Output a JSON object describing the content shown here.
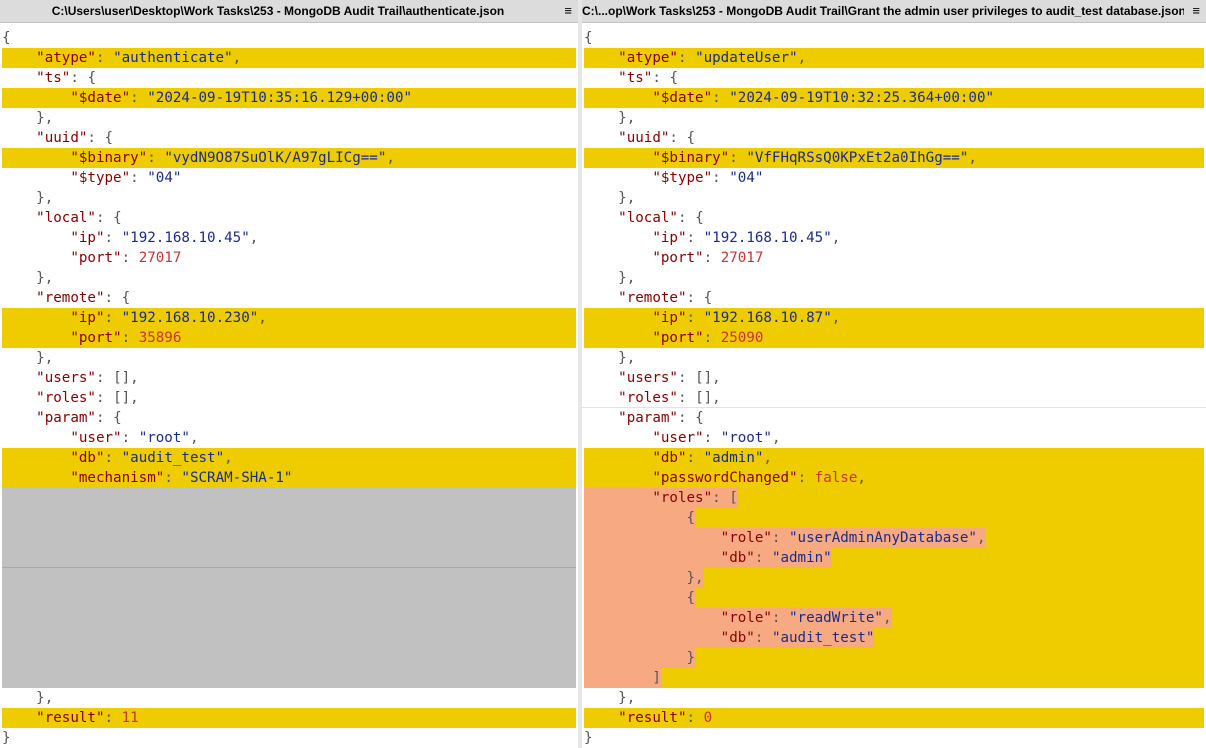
{
  "left_pane": {
    "title": "C:\\Users\\user\\Desktop\\Work Tasks\\253 - MongoDB Audit Trail\\authenticate.json",
    "menu_glyph": "≡",
    "lines": [
      "{",
      "    \"atype\": \"authenticate\",",
      "    \"ts\": {",
      "        \"$date\": \"2024-09-19T10:35:16.129+00:00\"",
      "    },",
      "    \"uuid\": {",
      "        \"$binary\": \"vydN9O87SuOlK/A97gLICg==\",",
      "        \"$type\": \"04\"",
      "    },",
      "    \"local\": {",
      "        \"ip\": \"192.168.10.45\",",
      "        \"port\": 27017",
      "    },",
      "    \"remote\": {",
      "        \"ip\": \"192.168.10.230\",",
      "        \"port\": 35896",
      "    },",
      "    \"users\": [],",
      "    \"roles\": [],",
      "    \"param\": {",
      "        \"user\": \"root\",",
      "        \"db\": \"audit_test\",",
      "        \"mechanism\": \"SCRAM-SHA-1\"",
      "    },",
      "    \"result\": 11",
      "}"
    ]
  },
  "right_pane": {
    "title": "C:\\...op\\Work Tasks\\253 - MongoDB Audit Trail\\Grant the admin user privileges to audit_test database.json",
    "menu_glyph": "≡",
    "lines": [
      "{",
      "    \"atype\": \"updateUser\",",
      "    \"ts\": {",
      "        \"$date\": \"2024-09-19T10:32:25.364+00:00\"",
      "    },",
      "    \"uuid\": {",
      "        \"$binary\": \"VfFHqRSsQ0KPxEt2a0IhGg==\",",
      "        \"$type\": \"04\"",
      "    },",
      "    \"local\": {",
      "        \"ip\": \"192.168.10.45\",",
      "        \"port\": 27017",
      "    },",
      "    \"remote\": {",
      "        \"ip\": \"192.168.10.87\",",
      "        \"port\": 25090",
      "    },",
      "    \"users\": [],",
      "    \"roles\": [],",
      "    \"param\": {",
      "        \"user\": \"root\",",
      "        \"db\": \"admin\",",
      "        \"passwordChanged\": false,",
      "        \"roles\": [",
      "            {",
      "                \"role\": \"userAdminAnyDatabase\",",
      "                \"db\": \"admin\"",
      "            },",
      "            {",
      "                \"role\": \"readWrite\",",
      "                \"db\": \"audit_test\"",
      "            }",
      "        ]",
      "    },",
      "    \"result\": 0",
      "}"
    ]
  },
  "colors": {
    "changed_line": "#eecc00",
    "changed_text": "#f3ddb0",
    "inserted_text": "#f7a982",
    "missing_block": "#c1c1c1",
    "title_bar": "#dcdcdc"
  }
}
